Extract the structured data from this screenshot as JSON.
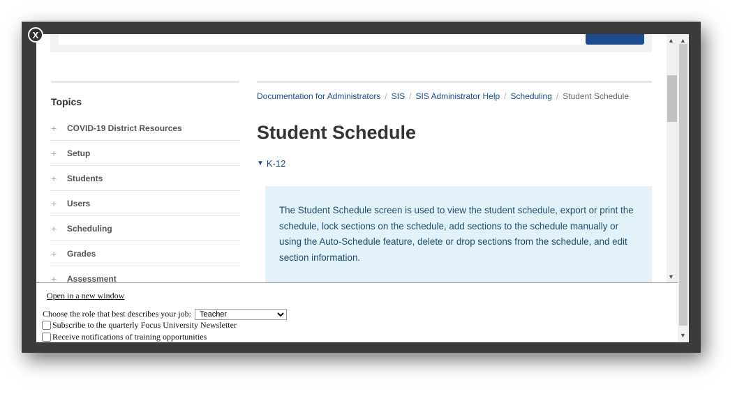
{
  "modal": {
    "close_label": "X"
  },
  "topics": {
    "title": "Topics",
    "items": [
      {
        "label": "COVID-19 District Resources"
      },
      {
        "label": "Setup"
      },
      {
        "label": "Students"
      },
      {
        "label": "Users"
      },
      {
        "label": "Scheduling"
      },
      {
        "label": "Grades"
      },
      {
        "label": "Assessment"
      }
    ]
  },
  "breadcrumb": {
    "items": [
      "Documentation for Administrators",
      "SIS",
      "SIS Administrator Help",
      "Scheduling"
    ],
    "current": "Student Schedule"
  },
  "article": {
    "title": "Student Schedule",
    "section_label": "K-12",
    "info_text": "The Student Schedule screen is used to view the student schedule, export or print the schedule, lock sections on the schedule, add sections to the schedule manually or using the Auto-Schedule feature, delete or drop sections from the schedule, and edit section information."
  },
  "footer": {
    "open_new_window": "Open in a new window",
    "role_label": "Choose the role that best describes your job:",
    "role_selected": "Teacher",
    "subscribe_label": "Subscribe to the quarterly Focus University Newsletter",
    "notifications_label": "Receive notifications of training opportunities"
  },
  "icons": {
    "plus": "+",
    "chevron_down": "▼",
    "scroll_up": "▲",
    "scroll_down": "▼"
  },
  "colors": {
    "brand_blue": "#1c4c8c",
    "info_bg": "#e3f2f8",
    "frame_dark": "#3b3b3b"
  }
}
